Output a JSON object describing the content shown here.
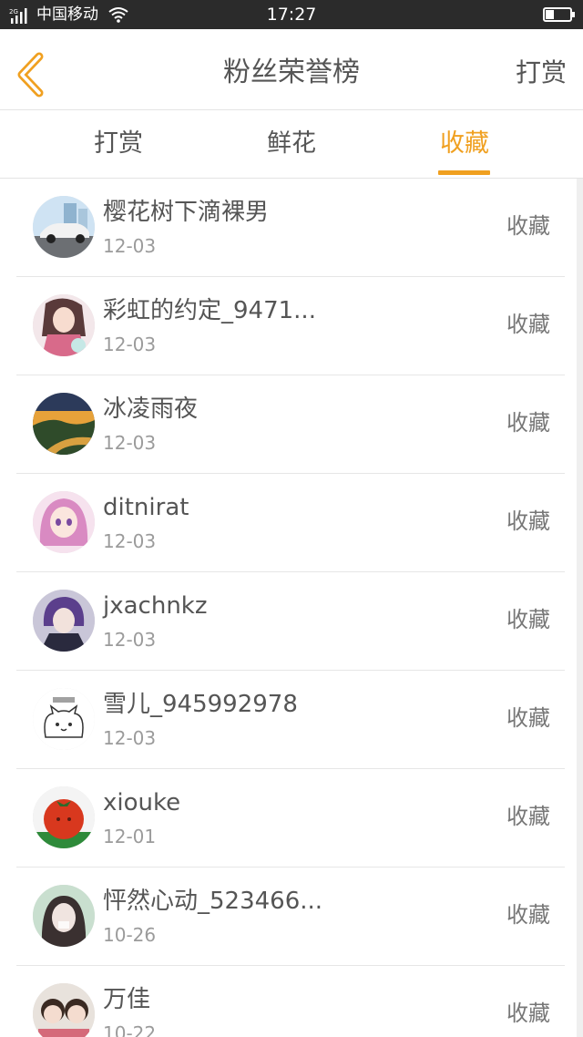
{
  "status_bar": {
    "carrier": "中国移动",
    "network": "2G",
    "time": "17:27"
  },
  "header": {
    "title": "粉丝荣誉榜",
    "action_label": "打赏",
    "accent_color": "#f0a020"
  },
  "tabs": [
    {
      "label": "打赏",
      "active": false
    },
    {
      "label": "鲜花",
      "active": false
    },
    {
      "label": "收藏",
      "active": true
    }
  ],
  "fans": [
    {
      "name": "樱花树下滴裸男",
      "date": "12-03",
      "action": "收藏",
      "avatar": "car-avatar"
    },
    {
      "name": "彩虹的约定_9471...",
      "date": "12-03",
      "action": "收藏",
      "avatar": "anime-girl-avatar"
    },
    {
      "name": "冰凌雨夜",
      "date": "12-03",
      "action": "收藏",
      "avatar": "sunset-road-avatar"
    },
    {
      "name": "ditnirat",
      "date": "12-03",
      "action": "收藏",
      "avatar": "pink-hair-girl-avatar"
    },
    {
      "name": "jxachnkz",
      "date": "12-03",
      "action": "收藏",
      "avatar": "purple-hair-boy-avatar"
    },
    {
      "name": "雪儿_945992978",
      "date": "12-03",
      "action": "收藏",
      "avatar": "white-cat-avatar"
    },
    {
      "name": "xiouke",
      "date": "12-01",
      "action": "收藏",
      "avatar": "tomato-avatar"
    },
    {
      "name": "怦然心动_523466...",
      "date": "10-26",
      "action": "收藏",
      "avatar": "girl-photo-avatar"
    },
    {
      "name": "万佳",
      "date": "10-22",
      "action": "收藏",
      "avatar": "kids-photo-avatar"
    }
  ]
}
